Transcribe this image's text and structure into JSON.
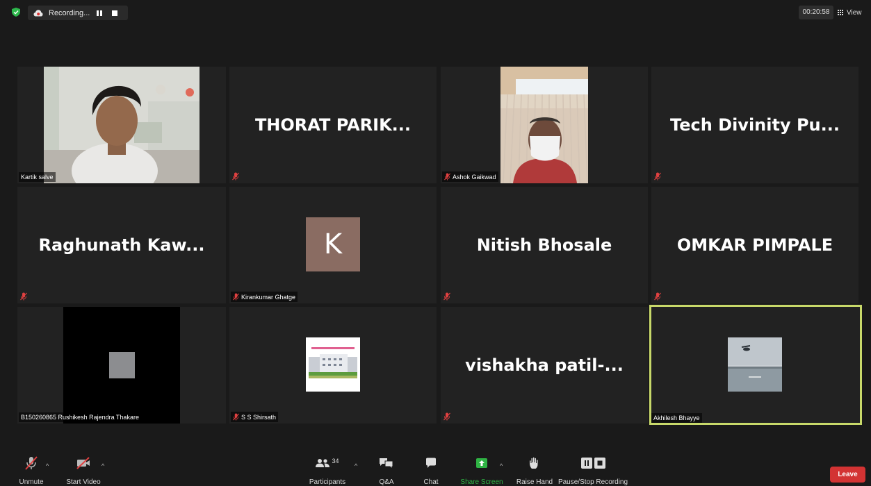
{
  "top_bar": {
    "recording_label": "Recording...",
    "timer": "00:20:58",
    "view_label": "View"
  },
  "tiles": [
    {
      "name": "Kartik salve",
      "type": "video"
    },
    {
      "name": "THORAT PARIK...",
      "type": "name"
    },
    {
      "name": "Ashok Gaikwad",
      "type": "video"
    },
    {
      "name": "Tech Divinity Pu...",
      "type": "name"
    },
    {
      "name": "Raghunath Kaw...",
      "type": "name"
    },
    {
      "name": "Kirankumar Ghatge",
      "type": "avatar",
      "initial": "K"
    },
    {
      "name": "Nitish Bhosale",
      "type": "name"
    },
    {
      "name": "OMKAR PIMPALE",
      "type": "name"
    },
    {
      "name": "B150260865 Rushikesh Rajendra Thakare",
      "type": "video"
    },
    {
      "name": "S S Shirsath",
      "type": "image"
    },
    {
      "name": "vishakha patil-...",
      "type": "name"
    },
    {
      "name": "Akhilesh Bhayye",
      "type": "image",
      "active_speaker": true
    }
  ],
  "toolbar": {
    "unmute": "Unmute",
    "start_video": "Start Video",
    "participants": "Participants",
    "participants_count": "34",
    "qa": "Q&A",
    "chat": "Chat",
    "share_screen": "Share Screen",
    "raise_hand": "Raise Hand",
    "pause_stop_recording": "Pause/Stop Recording",
    "leave": "Leave"
  },
  "colors": {
    "background": "#1a1a1a",
    "tile": "#222222",
    "active_speaker_border": "#c8d96a",
    "share_screen_green": "#2fb344",
    "leave_red": "#d33333",
    "muted_red": "#e04040",
    "avatar_k": "#8a6c62"
  },
  "icons": [
    "shield-check-icon",
    "cloud-record-icon",
    "pause-icon",
    "stop-icon",
    "grid-view-icon",
    "mic-muted-icon",
    "video-off-icon",
    "participants-icon",
    "qa-icon",
    "chat-icon",
    "share-screen-icon",
    "raise-hand-icon",
    "pause-stop-recording-icon"
  ]
}
